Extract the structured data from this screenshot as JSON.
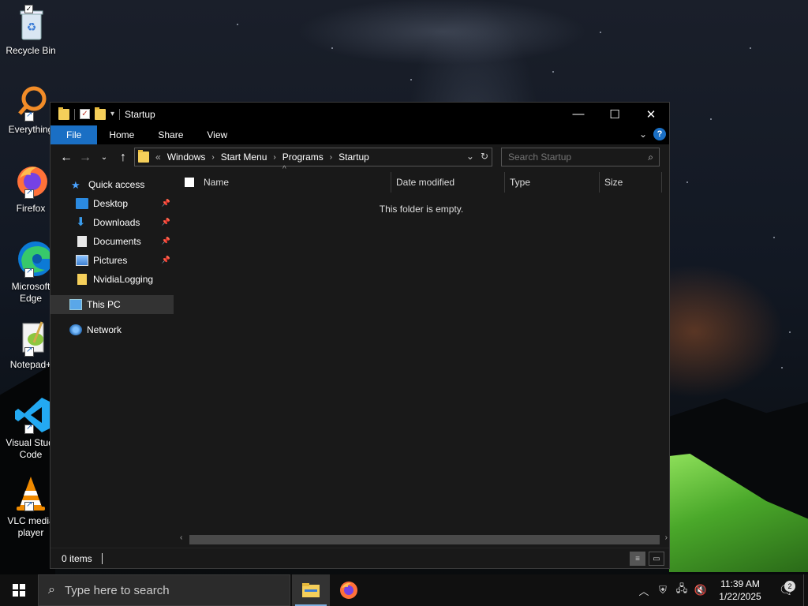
{
  "desktop": {
    "icons": [
      {
        "label": "Recycle Bin",
        "icon": "recycle-bin-icon"
      },
      {
        "label": "Everything",
        "icon": "everything-icon"
      },
      {
        "label": "Firefox",
        "icon": "firefox-icon"
      },
      {
        "label": "Microsoft Edge",
        "line1": "Microsoft",
        "line2": "Edge",
        "icon": "edge-icon"
      },
      {
        "label": "Notepad++",
        "line1": "Notepad+",
        "icon": "notepadpp-icon"
      },
      {
        "label": "Visual Studio Code",
        "line1": "Visual Studi",
        "line2": "Code",
        "icon": "vscode-icon"
      },
      {
        "label": "VLC media player",
        "line1": "VLC media",
        "line2": "player",
        "icon": "vlc-icon"
      }
    ]
  },
  "window": {
    "title": "Startup",
    "ribbon": {
      "tabs": [
        "File",
        "Home",
        "Share",
        "View"
      ]
    },
    "address": {
      "prefix": "«",
      "crumbs": [
        "Windows",
        "Start Menu",
        "Programs",
        "Startup"
      ]
    },
    "search": {
      "placeholder": "Search Startup"
    },
    "nav": {
      "quick_access": "Quick access",
      "items": [
        {
          "label": "Desktop",
          "pinned": true
        },
        {
          "label": "Downloads",
          "pinned": true
        },
        {
          "label": "Documents",
          "pinned": true
        },
        {
          "label": "Pictures",
          "pinned": true
        },
        {
          "label": "NvidiaLogging",
          "pinned": false
        }
      ],
      "this_pc": "This PC",
      "network": "Network"
    },
    "columns": [
      "Name",
      "Date modified",
      "Type",
      "Size"
    ],
    "empty_message": "This folder is empty.",
    "status": {
      "items": "0 items"
    }
  },
  "taskbar": {
    "search_placeholder": "Type here to search",
    "time": "11:39 AM",
    "date": "1/22/2025",
    "notification_count": "2"
  },
  "colors": {
    "accent": "#1a6fc4",
    "window_bg": "#191919",
    "titlebar_bg": "#000000",
    "taskbar_bg": "#101010",
    "folder_yellow": "#f5cf5a"
  }
}
